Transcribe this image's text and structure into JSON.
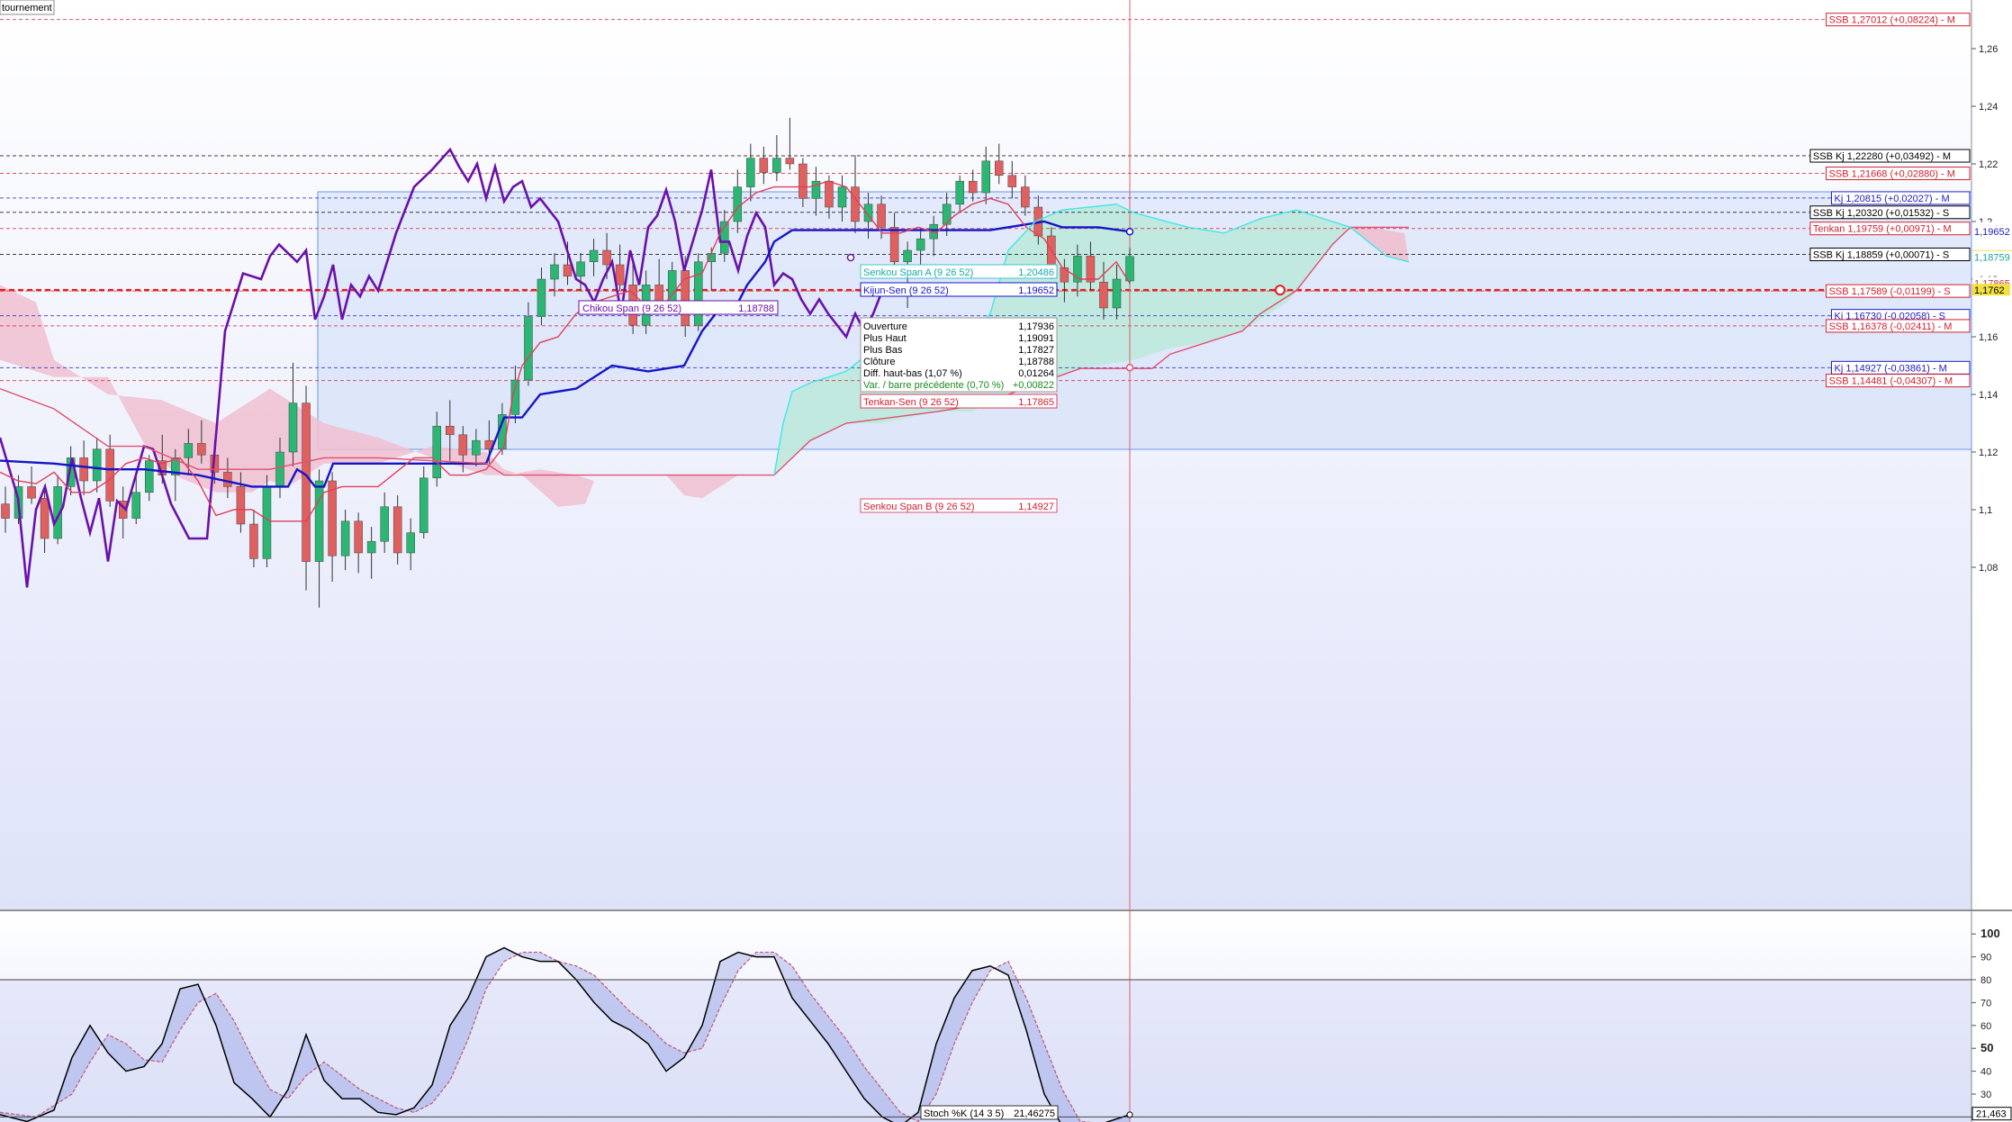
{
  "window": {
    "corner_label": "tournement"
  },
  "colors": {
    "bull": "#2bb673",
    "bear": "#e06060",
    "tenkan": "#e0405a",
    "kijun": "#1515c8",
    "chikou": "#6a11a8",
    "ssa": "#3ee8e8",
    "ssb": "#e05070",
    "kumo_bull": "#bfe9dc",
    "kumo_bear": "#f0c0d0",
    "main_bg": "#e9ecfa",
    "cursor": "#e06060",
    "stoch_k": "#000000",
    "stoch_d": "#c06080"
  },
  "price_axis": {
    "ticks": [
      "1,26",
      "1,24",
      "1,22",
      "1,2",
      "1,18",
      "1,16",
      "1,14",
      "1,12",
      "1,1",
      "1,08"
    ],
    "markers": [
      {
        "text": "1,19759",
        "color": "#c83040",
        "bg": "#ffffff"
      },
      {
        "text": "1,19652",
        "color": "#2020c0",
        "bg": "#ffffff"
      },
      {
        "text": "1,18788",
        "color": "#000000",
        "bg": "#f0e040"
      },
      {
        "text": "1,18759",
        "color": "#20a0a0",
        "bg": "#ffffff"
      },
      {
        "text": "1,17865",
        "color": "#c83040",
        "bg": "#ffffff"
      },
      {
        "text": "1,1762",
        "color": "#000000",
        "bg": "#f0e040"
      }
    ]
  },
  "level_labels": [
    {
      "text": "SSB 1,27012 (+0,08224) - M",
      "color": "#d02030"
    },
    {
      "text": "SSB Kj 1,22280 (+0,03492) - M",
      "color": "#000000"
    },
    {
      "text": "SSB 1,21668 (+0,02880) - M",
      "color": "#d02030"
    },
    {
      "text": "Kj 1,20815 (+0,02027) - M",
      "color": "#2020c0"
    },
    {
      "text": "SSB Kj 1,20320 (+0,01532) - S",
      "color": "#000000"
    },
    {
      "text": "Tenkan 1,19759 (+0,00971) - M",
      "color": "#d02030"
    },
    {
      "text": "SSB Kj 1,18859 (+0,00071) - S",
      "color": "#000000"
    },
    {
      "text": "SSB 1,17589 (-0,01199) - S",
      "color": "#d02030"
    },
    {
      "text": "Kj 1,16730 (-0,02058) - S",
      "color": "#2020c0"
    },
    {
      "text": "SSB 1,16378 (-0,02411) - M",
      "color": "#d02030"
    },
    {
      "text": "Kj 1,14927 (-0,03861) - M",
      "color": "#2020c0"
    },
    {
      "text": "SSB 1,14481 (-0,04307) - M",
      "color": "#d02030"
    }
  ],
  "indicator_labels": {
    "chikou": {
      "name": "Chikou Span (9 26 52)",
      "value": "1,18788"
    },
    "ssa": {
      "name": "Senkou Span A (9 26 52)",
      "value": "1,20486"
    },
    "kijun": {
      "name": "Kijun-Sen (9 26 52)",
      "value": "1,19652"
    },
    "tenkan": {
      "name": "Tenkan-Sen (9 26 52)",
      "value": "1,17865"
    },
    "ssb": {
      "name": "Senkou Span B (9 26 52)",
      "value": "1,14927"
    }
  },
  "ohlc_tooltip": {
    "rows": [
      {
        "label": "Ouverture",
        "value": "1,17936"
      },
      {
        "label": "Plus Haut",
        "value": "1,19091"
      },
      {
        "label": "Plus Bas",
        "value": "1,17827"
      },
      {
        "label": "Clôture",
        "value": "1,18788"
      },
      {
        "label": "Diff. haut-bas (1,07 %)",
        "value": "0,01264"
      }
    ],
    "var_label": "Var. / barre précédente (0,70 %)",
    "var_value": "+0,00822"
  },
  "stoch": {
    "label": "Stoch %K (14 3 5)",
    "value": "21,46275",
    "axis_ticks": [
      "100",
      "90",
      "80",
      "70",
      "60",
      "50",
      "40",
      "30"
    ],
    "last_value_marker": "21,463"
  },
  "chart_data": {
    "type": "candlestick",
    "panels": [
      "price",
      "stochastic"
    ],
    "y_range": [
      1.05,
      1.27
    ],
    "series": [
      {
        "name": "Chikou Span (9 26 52)",
        "last": 1.18788
      },
      {
        "name": "Senkou Span A (9 26 52)",
        "last": 1.20486
      },
      {
        "name": "Kijun-Sen (9 26 52)",
        "last": 1.19652
      },
      {
        "name": "Tenkan-Sen (9 26 52)",
        "last": 1.17865
      },
      {
        "name": "Senkou Span B (9 26 52)",
        "last": 1.14927
      },
      {
        "name": "Stoch %K (14 3 5)",
        "last": 21.46275
      }
    ],
    "ohlc": [
      [
        1.102,
        1.108,
        1.092,
        1.097
      ],
      [
        1.097,
        1.112,
        1.095,
        1.108
      ],
      [
        1.108,
        1.115,
        1.102,
        1.104
      ],
      [
        1.104,
        1.108,
        1.085,
        1.09
      ],
      [
        1.09,
        1.112,
        1.088,
        1.108
      ],
      [
        1.108,
        1.122,
        1.105,
        1.118
      ],
      [
        1.118,
        1.124,
        1.105,
        1.11
      ],
      [
        1.11,
        1.125,
        1.106,
        1.121
      ],
      [
        1.121,
        1.126,
        1.101,
        1.103
      ],
      [
        1.103,
        1.108,
        1.09,
        1.097
      ],
      [
        1.097,
        1.112,
        1.095,
        1.106
      ],
      [
        1.106,
        1.119,
        1.103,
        1.117
      ],
      [
        1.117,
        1.126,
        1.109,
        1.112
      ],
      [
        1.112,
        1.121,
        1.103,
        1.118
      ],
      [
        1.118,
        1.128,
        1.112,
        1.123
      ],
      [
        1.123,
        1.131,
        1.116,
        1.119
      ],
      [
        1.119,
        1.124,
        1.109,
        1.113
      ],
      [
        1.113,
        1.118,
        1.104,
        1.108
      ],
      [
        1.108,
        1.113,
        1.092,
        1.095
      ],
      [
        1.095,
        1.1,
        1.08,
        1.083
      ],
      [
        1.083,
        1.112,
        1.08,
        1.108
      ],
      [
        1.108,
        1.125,
        1.104,
        1.12
      ],
      [
        1.12,
        1.151,
        1.115,
        1.137
      ],
      [
        1.137,
        1.143,
        1.072,
        1.082
      ],
      [
        1.082,
        1.114,
        1.066,
        1.11
      ],
      [
        1.11,
        1.113,
        1.075,
        1.084
      ],
      [
        1.084,
        1.1,
        1.079,
        1.096
      ],
      [
        1.096,
        1.099,
        1.078,
        1.085
      ],
      [
        1.085,
        1.094,
        1.076,
        1.089
      ],
      [
        1.089,
        1.106,
        1.085,
        1.101
      ],
      [
        1.101,
        1.105,
        1.081,
        1.085
      ],
      [
        1.085,
        1.097,
        1.079,
        1.092
      ],
      [
        1.092,
        1.115,
        1.09,
        1.111
      ],
      [
        1.111,
        1.134,
        1.108,
        1.129
      ],
      [
        1.129,
        1.138,
        1.117,
        1.126
      ],
      [
        1.126,
        1.129,
        1.113,
        1.119
      ],
      [
        1.119,
        1.128,
        1.115,
        1.124
      ],
      [
        1.124,
        1.131,
        1.116,
        1.121
      ],
      [
        1.121,
        1.137,
        1.119,
        1.133
      ],
      [
        1.133,
        1.15,
        1.13,
        1.145
      ],
      [
        1.145,
        1.172,
        1.143,
        1.167
      ],
      [
        1.167,
        1.184,
        1.164,
        1.18
      ],
      [
        1.18,
        1.189,
        1.174,
        1.185
      ],
      [
        1.185,
        1.193,
        1.178,
        1.181
      ],
      [
        1.181,
        1.189,
        1.176,
        1.186
      ],
      [
        1.186,
        1.194,
        1.181,
        1.19
      ],
      [
        1.19,
        1.196,
        1.18,
        1.185
      ],
      [
        1.185,
        1.192,
        1.176,
        1.178
      ],
      [
        1.178,
        1.187,
        1.161,
        1.164
      ],
      [
        1.164,
        1.183,
        1.161,
        1.178
      ],
      [
        1.178,
        1.187,
        1.168,
        1.171
      ],
      [
        1.171,
        1.186,
        1.168,
        1.183
      ],
      [
        1.183,
        1.188,
        1.16,
        1.164
      ],
      [
        1.164,
        1.189,
        1.162,
        1.186
      ],
      [
        1.186,
        1.191,
        1.176,
        1.189
      ],
      [
        1.189,
        1.204,
        1.186,
        1.2
      ],
      [
        1.2,
        1.218,
        1.196,
        1.212
      ],
      [
        1.212,
        1.227,
        1.207,
        1.222
      ],
      [
        1.222,
        1.226,
        1.213,
        1.217
      ],
      [
        1.217,
        1.23,
        1.214,
        1.222
      ],
      [
        1.222,
        1.236,
        1.218,
        1.22
      ],
      [
        1.22,
        1.222,
        1.205,
        1.208
      ],
      [
        1.208,
        1.219,
        1.202,
        1.214
      ],
      [
        1.214,
        1.216,
        1.201,
        1.205
      ],
      [
        1.205,
        1.216,
        1.2,
        1.212
      ],
      [
        1.212,
        1.223,
        1.196,
        1.2
      ],
      [
        1.2,
        1.21,
        1.194,
        1.206
      ],
      [
        1.206,
        1.209,
        1.194,
        1.198
      ],
      [
        1.198,
        1.203,
        1.182,
        1.186
      ],
      [
        1.186,
        1.193,
        1.17,
        1.19
      ],
      [
        1.19,
        1.198,
        1.183,
        1.194
      ],
      [
        1.194,
        1.202,
        1.188,
        1.199
      ],
      [
        1.199,
        1.21,
        1.195,
        1.206
      ],
      [
        1.206,
        1.216,
        1.203,
        1.214
      ],
      [
        1.214,
        1.218,
        1.207,
        1.21
      ],
      [
        1.21,
        1.226,
        1.206,
        1.221
      ],
      [
        1.221,
        1.227,
        1.213,
        1.216
      ],
      [
        1.216,
        1.221,
        1.208,
        1.212
      ],
      [
        1.212,
        1.216,
        1.202,
        1.205
      ],
      [
        1.205,
        1.209,
        1.192,
        1.195
      ],
      [
        1.195,
        1.198,
        1.18,
        1.184
      ],
      [
        1.184,
        1.187,
        1.172,
        1.179
      ],
      [
        1.179,
        1.192,
        1.174,
        1.188
      ],
      [
        1.188,
        1.193,
        1.176,
        1.179
      ],
      [
        1.179,
        1.186,
        1.166,
        1.17
      ],
      [
        1.17,
        1.185,
        1.166,
        1.18
      ],
      [
        1.17936,
        1.19091,
        1.17827,
        1.18788
      ]
    ]
  }
}
